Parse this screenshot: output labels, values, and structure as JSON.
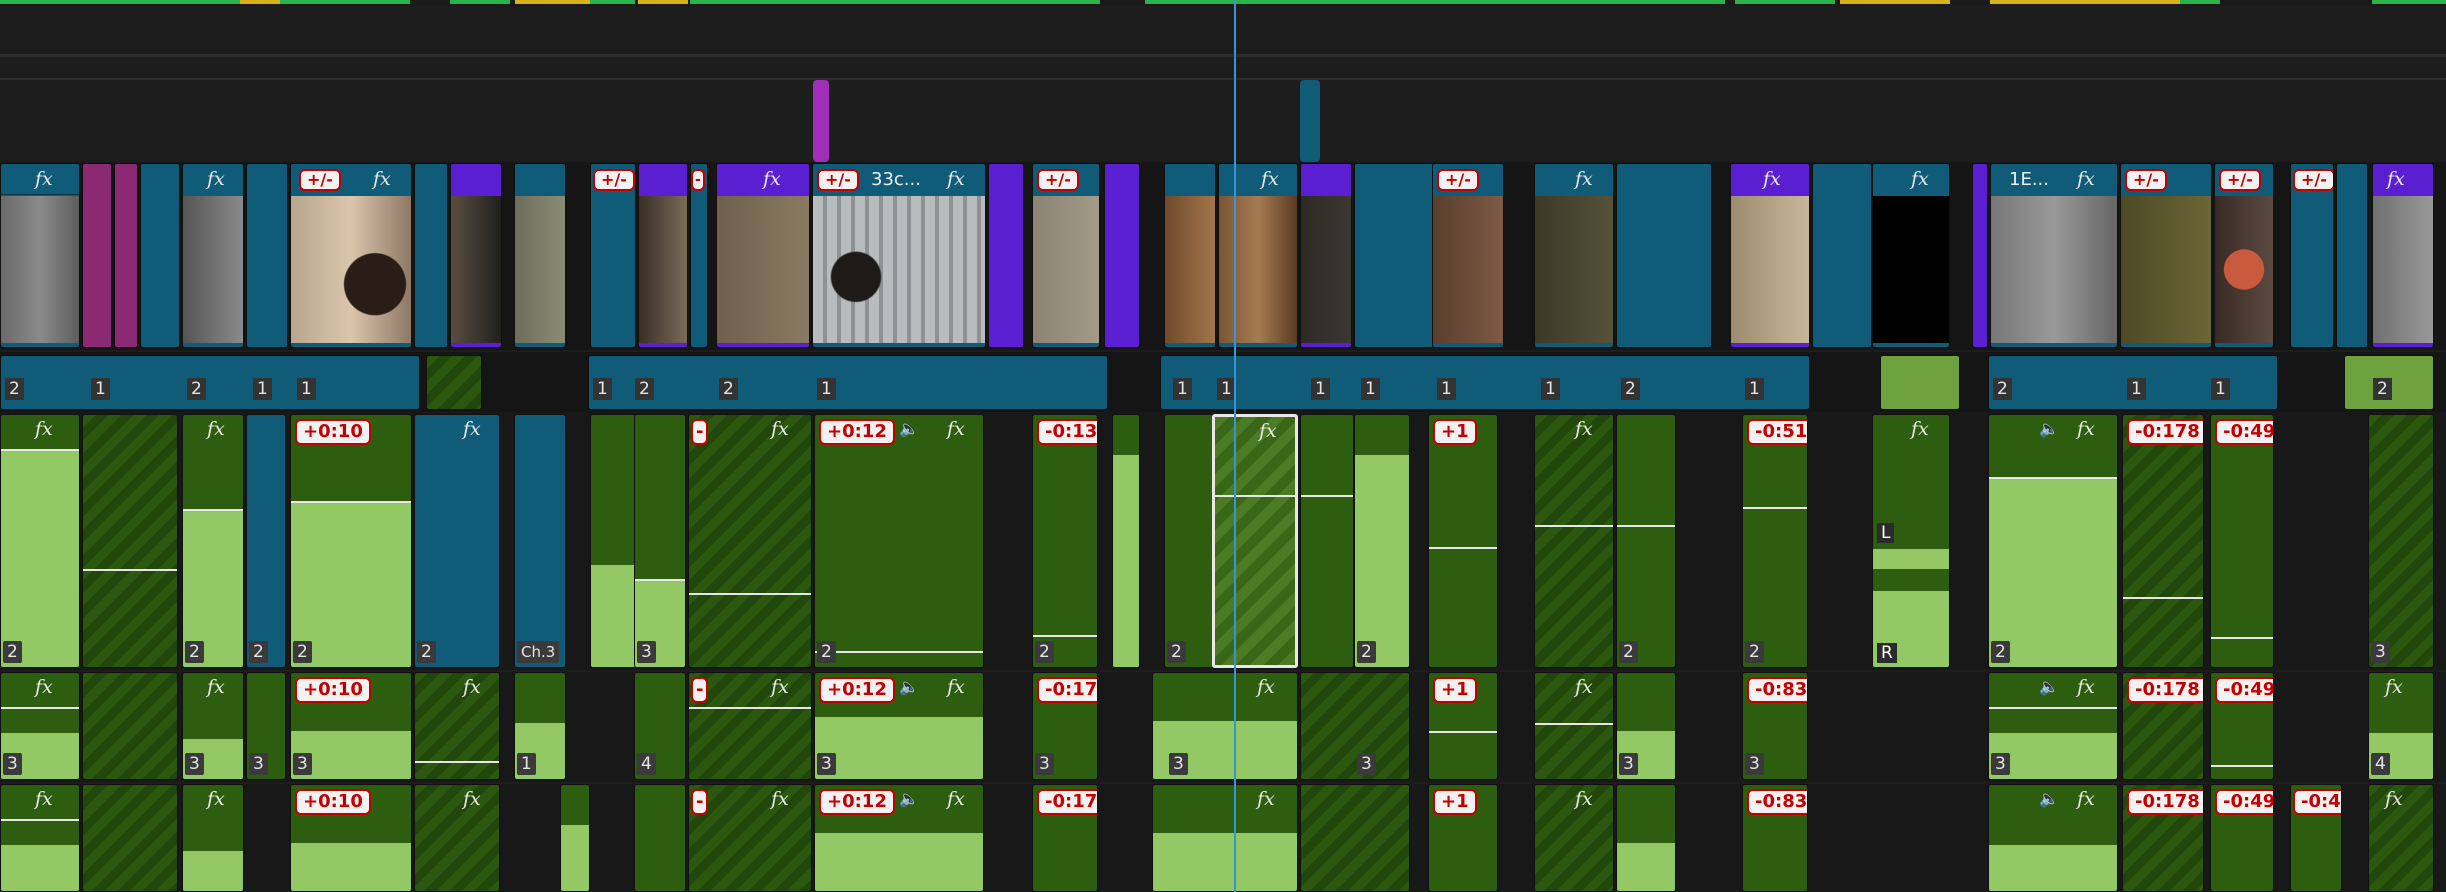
{
  "colors": {
    "video_clip": "#0f5b78",
    "video_clip_nested": "#5a1fd0",
    "audio_clip": "#2d5d0f",
    "waveform": "#93c965",
    "badge_text": "#c40000",
    "playhead": "#3a92d8",
    "marker_magenta": "#a02fb8",
    "marker_blue": "#0f5b78",
    "ruler_green": "#2bb24c",
    "ruler_yellow": "#d6b21d"
  },
  "icons": {
    "fx": "fx-icon",
    "voice": "voice-icon",
    "keyframe": "keyframe-icon",
    "playhead": "playhead-line"
  },
  "labels": {
    "fx": "fx",
    "pm": "+/-",
    "clip_33c": "33c...",
    "clip_1e": "1E...",
    "ch3": "Ch.3",
    "L": "L",
    "R": "R",
    "voice": "🔈"
  },
  "badges": {
    "p010": "+0:10",
    "p012": "+0:12",
    "m013": "-0:13",
    "m017": "-0:17",
    "p1": "+1",
    "m051": "-0:51",
    "m083": "-0:83",
    "m0178": "-0:178",
    "m049": "-0:49",
    "m04": "-0:4",
    "dash": "-"
  },
  "nums": {
    "n1": "1",
    "n2": "2",
    "n3": "3",
    "n4": "4"
  }
}
